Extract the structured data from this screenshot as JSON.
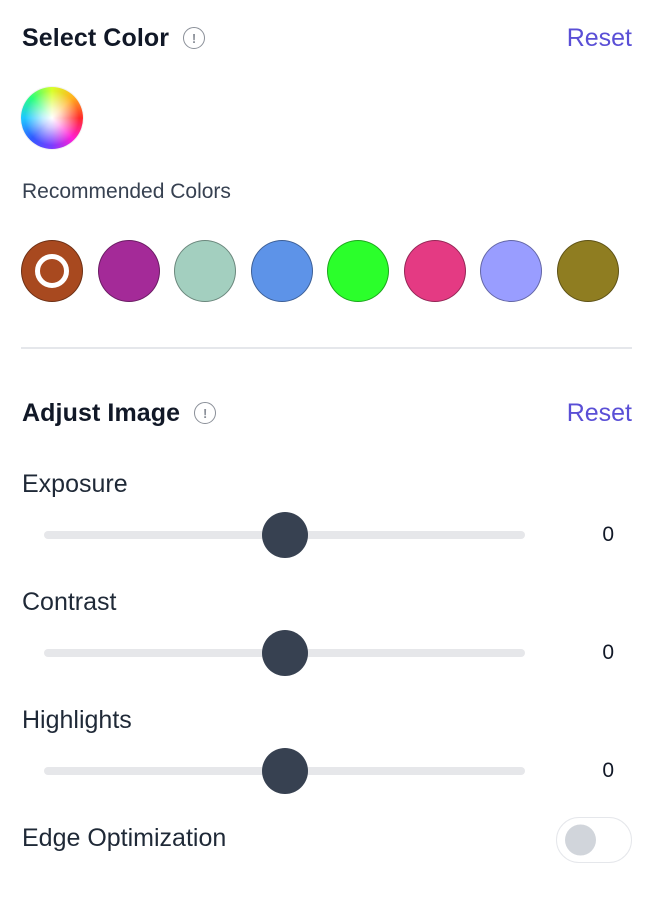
{
  "select_color": {
    "title": "Select Color",
    "info_icon": "info-circle-icon",
    "reset_label": "Reset",
    "color_wheel_icon": "color-wheel-icon",
    "recommended_label": "Recommended Colors",
    "swatches": [
      {
        "color": "#a8491f",
        "selected": true
      },
      {
        "color": "#a42a98",
        "selected": false
      },
      {
        "color": "#a3cfbf",
        "selected": false
      },
      {
        "color": "#5d93e8",
        "selected": false
      },
      {
        "color": "#2bff2b",
        "selected": false
      },
      {
        "color": "#e43a83",
        "selected": false
      },
      {
        "color": "#999dff",
        "selected": false
      },
      {
        "color": "#8f7d21",
        "selected": false
      }
    ]
  },
  "adjust_image": {
    "title": "Adjust Image",
    "info_icon": "info-circle-icon",
    "reset_label": "Reset",
    "sliders": [
      {
        "label": "Exposure",
        "value": "0",
        "position": 0.5
      },
      {
        "label": "Contrast",
        "value": "0",
        "position": 0.5
      },
      {
        "label": "Highlights",
        "value": "0",
        "position": 0.5
      }
    ],
    "edge_optimization": {
      "label": "Edge Optimization",
      "enabled": false
    }
  },
  "colors": {
    "accent": "#5a4fd6",
    "slider_thumb": "#374151",
    "track": "#e6e7ea"
  }
}
